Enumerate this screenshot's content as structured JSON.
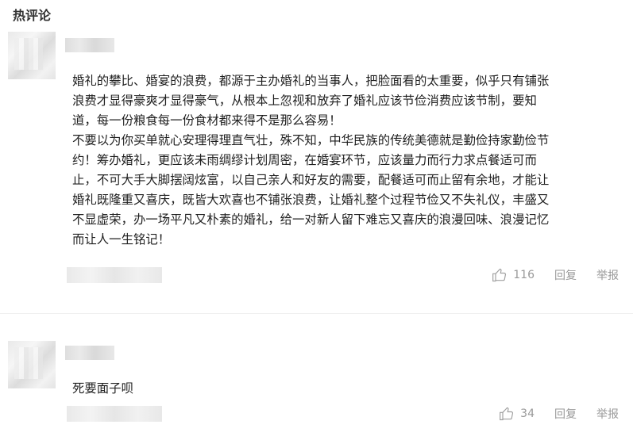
{
  "section": {
    "title": "热评论"
  },
  "comments": [
    {
      "text": "婚礼的攀比、婚宴的浪费，都源于主办婚礼的当事人，把脸面看的太重要，似乎只有铺张\n浪费才显得豪爽才显得豪气，从根本上忽视和放弃了婚礼应该节俭消费应该节制，要知\n道，每一份粮食每一份食材都来得不是那么容易！\n不要以为你买单就心安理得理直气壮，殊不知，中华民族的传统美德就是勤俭持家勤俭节\n约！筹办婚礼，更应该未雨绸缪计划周密，在婚宴环节，应该量力而行力求点餐适可而\n止，不可大手大脚摆阔炫富，以自己亲人和好友的需要，配餐适可而止留有余地，才能让\n婚礼既隆重又喜庆，既皆大欢喜也不铺张浪费，让婚礼整个过程节俭又不失礼仪，丰盛又\n不显虚荣，办一场平凡又朴素的婚礼，给一对新人留下难忘又喜庆的浪漫回味、浪漫记忆\n而让人一生铭记！",
      "likes": "116",
      "reply_label": "回复",
      "report_label": "举报",
      "like_icon": "thumbs-up-icon"
    },
    {
      "text": "死要面子呗",
      "likes": "34",
      "reply_label": "回复",
      "report_label": "举报",
      "like_icon": "thumbs-up-icon"
    }
  ],
  "colors": {
    "action_gray": "#999999",
    "text": "#1f1f1f"
  }
}
